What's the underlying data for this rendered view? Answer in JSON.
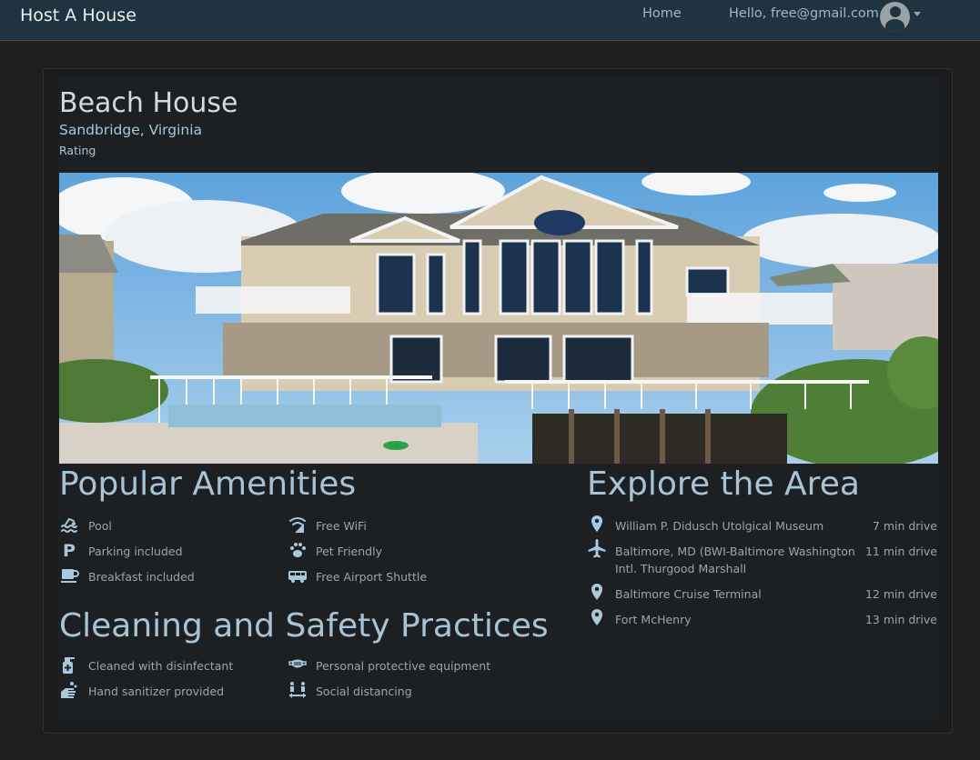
{
  "nav": {
    "brand": "Host A House",
    "home": "Home",
    "greeting": "Hello, free@gmail.com"
  },
  "listing": {
    "title": "Beach House",
    "location": "Sandbridge, Virginia",
    "rating_label": "Rating"
  },
  "amenities": {
    "heading": "Popular Amenities",
    "items": [
      {
        "label": "Pool",
        "icon": "swimming-icon"
      },
      {
        "label": "Free WiFi",
        "icon": "wifi-icon"
      },
      {
        "label": "Parking included",
        "icon": "parking-icon"
      },
      {
        "label": "Pet Friendly",
        "icon": "paw-icon"
      },
      {
        "label": "Breakfast included",
        "icon": "coffee-icon"
      },
      {
        "label": "Free Airport Shuttle",
        "icon": "shuttle-icon"
      }
    ]
  },
  "safety": {
    "heading": "Cleaning and Safety Practices",
    "items": [
      {
        "label": "Cleaned with disinfectant",
        "icon": "spray-bottle-icon"
      },
      {
        "label": "Personal protective equipment",
        "icon": "mask-icon"
      },
      {
        "label": "Hand sanitizer provided",
        "icon": "hands-wash-icon"
      },
      {
        "label": "Social distancing",
        "icon": "distancing-icon"
      }
    ]
  },
  "explore": {
    "heading": "Explore the Area",
    "places": [
      {
        "name": "William P. Didusch Utolgical Museum",
        "drive": "7 min drive",
        "icon": "map-pin-icon"
      },
      {
        "name_line1": "Baltimore, MD (BWI-Baltimore Washington",
        "name_line2": "Intl. Thurgood Marshall",
        "drive": "11 min drive",
        "icon": "plane-icon"
      },
      {
        "name": "Baltimore Cruise Terminal",
        "drive": "12 min drive",
        "icon": "map-pin-icon"
      },
      {
        "name": "Fort McHenry",
        "drive": "13 min drive",
        "icon": "map-pin-icon"
      }
    ]
  },
  "colors": {
    "navbar": "#1f3340",
    "page_bg": "#1c1e20",
    "heading": "#a7c4d6",
    "icon": "#a9c8dc"
  }
}
